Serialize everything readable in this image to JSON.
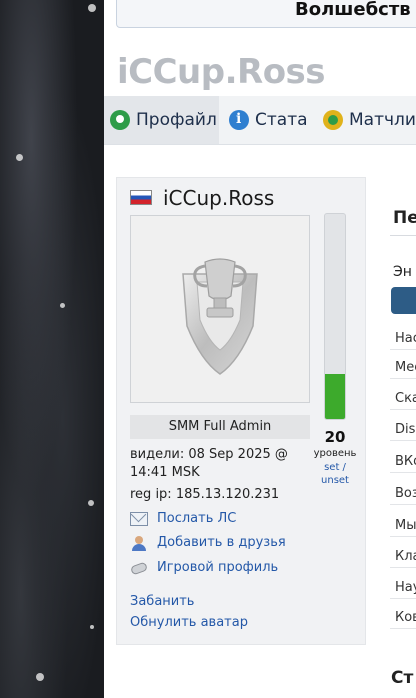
{
  "banner": {
    "text": "Волшебств"
  },
  "page_title": "iCCup.Ross",
  "tabs": [
    {
      "label": "Профайл",
      "icon": "profile-icon",
      "active": true
    },
    {
      "label": "Стата",
      "icon": "info-icon",
      "active": false
    },
    {
      "label": "Матчли",
      "icon": "matches-icon",
      "active": false
    }
  ],
  "profile": {
    "flag": "ru-flag-icon",
    "name": "iCCup.Ross",
    "role": "SMM Full Admin",
    "seen": "видели: 08 Sep 2025 @ 14:41 MSK",
    "reg_ip": "reg ip: 185.13.120.231",
    "actions": {
      "message": "Послать ЛС",
      "add_friend": "Добавить в друзья",
      "game_profile": "Игровой профиль"
    },
    "ban": "Забанить",
    "reset_avatar": "Обнулить аватар"
  },
  "level": {
    "value": "20",
    "word": "уровень",
    "set": "set /",
    "unset": "unset",
    "fill_percent": 22
  },
  "right_column": {
    "heading": "Пе",
    "subheading": "Эн",
    "rows": [
      "Нас",
      "Мес",
      "Ска",
      "Disc",
      "ВКо",
      "Воз",
      "Мы",
      "Кла",
      "Нау",
      "Ков"
    ],
    "bottom_heading": "Ст"
  },
  "colors": {
    "accent": "#2458a8",
    "level_fill": "#3daa2c",
    "title_gray": "#b8bcc2"
  }
}
